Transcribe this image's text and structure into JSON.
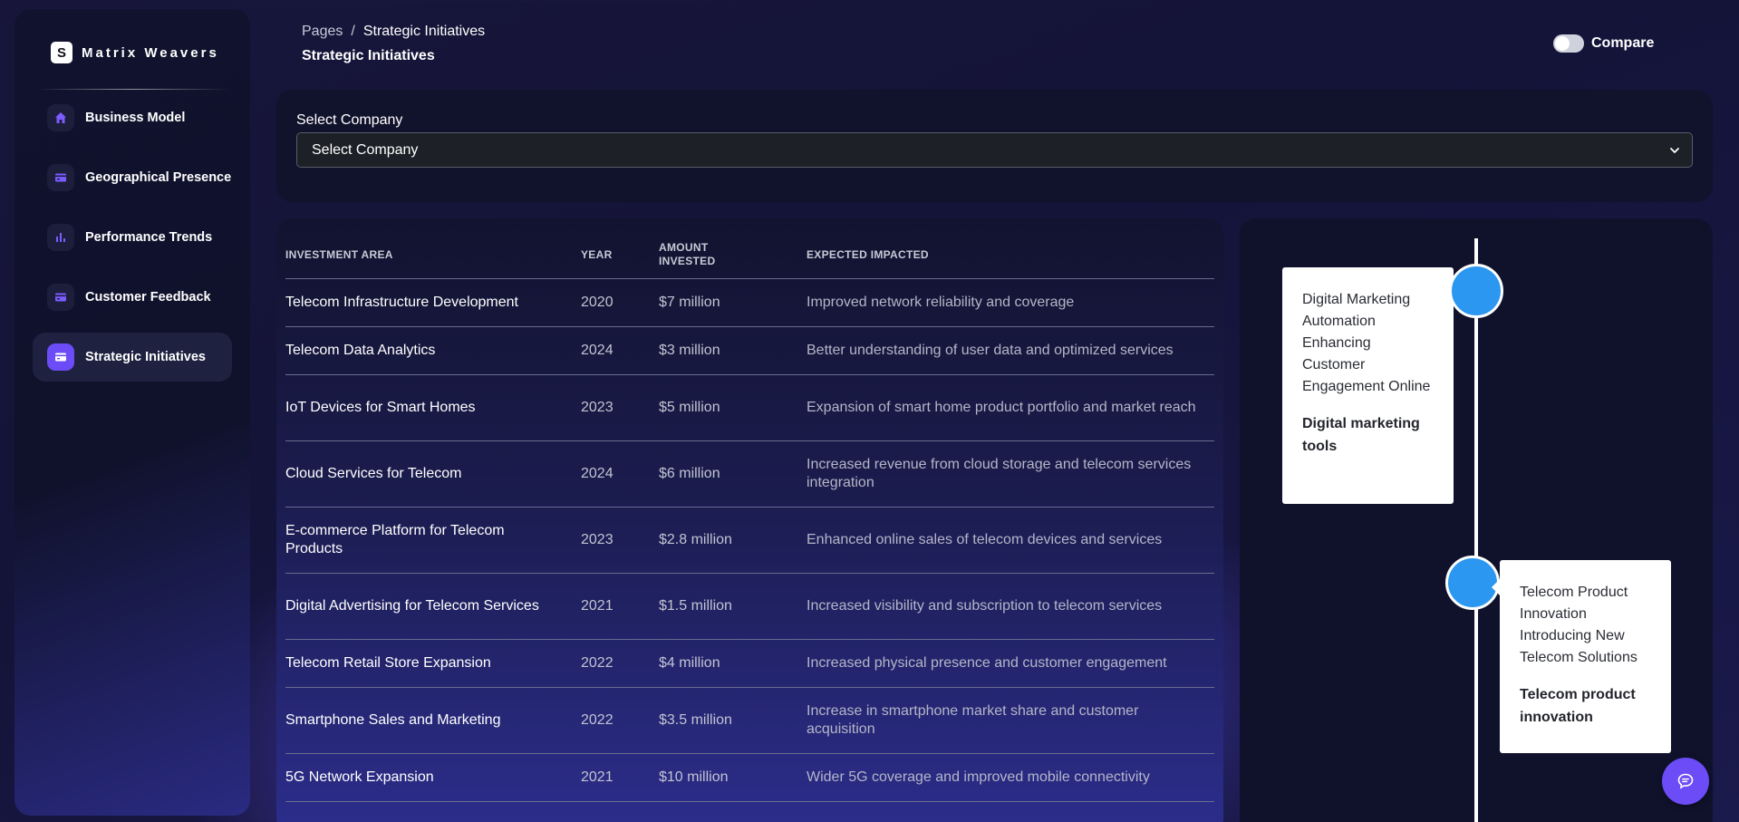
{
  "app": {
    "logo_letter": "S",
    "name": "Matrix Weavers"
  },
  "sidebar": {
    "items": [
      {
        "label": "Business Model",
        "icon": "home-icon",
        "active": false
      },
      {
        "label": "Geographical Presence",
        "icon": "card-icon",
        "active": false
      },
      {
        "label": "Performance Trends",
        "icon": "bar-chart-icon",
        "active": false
      },
      {
        "label": "Customer Feedback",
        "icon": "card-icon",
        "active": false
      },
      {
        "label": "Strategic Initiatives",
        "icon": "card-icon",
        "active": true
      }
    ]
  },
  "header": {
    "breadcrumb_root": "Pages",
    "breadcrumb_sep": "/",
    "breadcrumb_current": "Strategic Initiatives",
    "title": "Strategic Initiatives",
    "compare_label": "Compare",
    "compare_on": false
  },
  "company_select": {
    "label": "Select Company",
    "value": "Select Company"
  },
  "table": {
    "columns": [
      "INVESTMENT AREA",
      "YEAR",
      "AMOUNT INVESTED",
      "EXPECTED IMPACTED"
    ],
    "rows": [
      {
        "area": "Telecom Infrastructure Development",
        "year": "2020",
        "amount": "$7 million",
        "impact": "Improved network reliability and coverage"
      },
      {
        "area": "Telecom Data Analytics",
        "year": "2024",
        "amount": "$3 million",
        "impact": "Better understanding of user data and optimized services"
      },
      {
        "area": "IoT Devices for Smart Homes",
        "year": "2023",
        "amount": "$5 million",
        "impact": "Expansion of smart home product portfolio and market reach"
      },
      {
        "area": "Cloud Services for Telecom",
        "year": "2024",
        "amount": "$6 million",
        "impact": "Increased revenue from cloud storage and telecom services integration"
      },
      {
        "area": "E-commerce Platform for Telecom Products",
        "year": "2023",
        "amount": "$2.8 million",
        "impact": "Enhanced online sales of telecom devices and services"
      },
      {
        "area": "Digital Advertising for Telecom Services",
        "year": "2021",
        "amount": "$1.5 million",
        "impact": "Increased visibility and subscription to telecom services"
      },
      {
        "area": "Telecom Retail Store Expansion",
        "year": "2022",
        "amount": "$4 million",
        "impact": "Increased physical presence and customer engagement"
      },
      {
        "area": "Smartphone Sales and Marketing",
        "year": "2022",
        "amount": "$3.5 million",
        "impact": "Increase in smartphone market share and customer acquisition"
      },
      {
        "area": "5G Network Expansion",
        "year": "2021",
        "amount": "$10 million",
        "impact": "Wider 5G coverage and improved mobile connectivity"
      }
    ]
  },
  "timeline": {
    "items": [
      {
        "description": "Digital Marketing Automation Enhancing Customer Engagement Online",
        "title": "Digital marketing tools",
        "side": "left"
      },
      {
        "description": "Telecom Product Innovation Introducing New Telecom Solutions",
        "title": "Telecom product innovation",
        "side": "right"
      }
    ],
    "dot_color": "#2b97f0"
  },
  "colors": {
    "accent": "#6b4cf6",
    "timeline_dot": "#2b97f0"
  },
  "chat_button": {
    "icon": "chat-icon"
  }
}
